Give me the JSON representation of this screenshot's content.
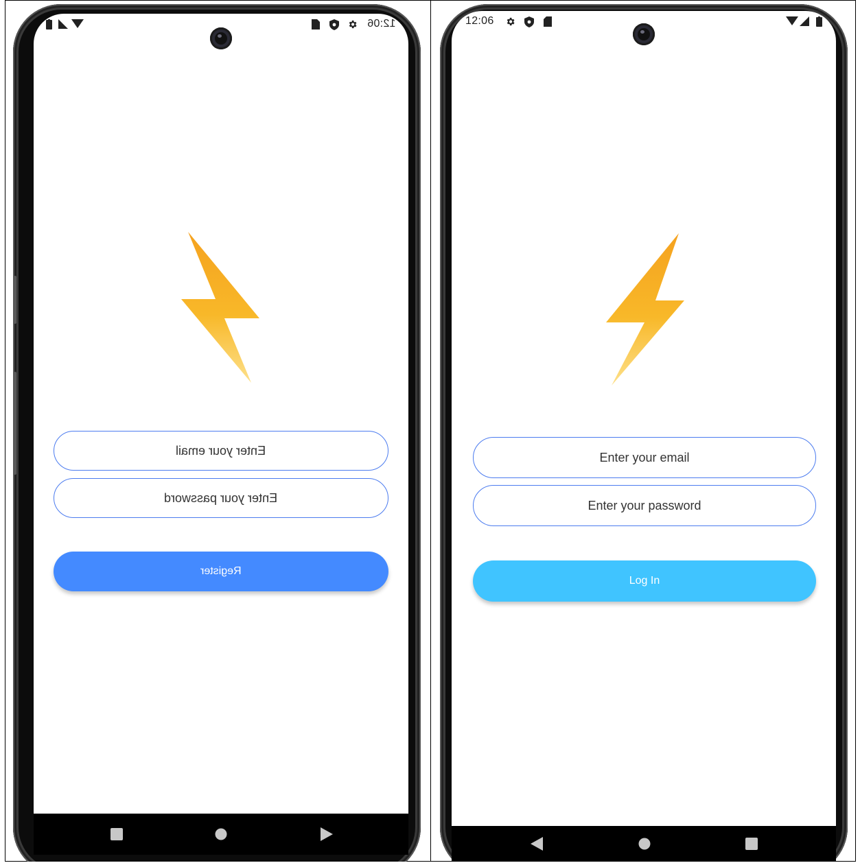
{
  "register_screen": {
    "status_bar": {
      "time": "12:06",
      "icons": [
        "sd-card-icon",
        "shield-icon",
        "gear-icon",
        "wifi-icon",
        "signal-icon",
        "battery-icon"
      ]
    },
    "logo": "lightning-bolt-icon",
    "email_field": {
      "placeholder": "Enter your email"
    },
    "password_field": {
      "placeholder": "Enter your password"
    },
    "submit_button": {
      "label": "Register",
      "color": "#448aff"
    },
    "nav_bar": {
      "icons": [
        "recents-icon",
        "home-icon",
        "back-icon"
      ]
    },
    "mirrored": true
  },
  "login_screen": {
    "status_bar": {
      "time": "12:06",
      "icons": [
        "gear-icon",
        "shield-icon",
        "sd-card-icon",
        "wifi-icon",
        "signal-icon",
        "battery-icon"
      ]
    },
    "logo": "lightning-bolt-icon",
    "email_field": {
      "placeholder": "Enter your email"
    },
    "password_field": {
      "placeholder": "Enter your password"
    },
    "submit_button": {
      "label": "Log In",
      "color": "#40c4ff"
    },
    "nav_bar": {
      "icons": [
        "back-icon",
        "home-icon",
        "recents-icon"
      ]
    },
    "mirrored": false
  },
  "colors": {
    "field_border": "#4b7bef",
    "bolt_top": "#f5a21f",
    "bolt_bottom": "#fdd35f"
  }
}
